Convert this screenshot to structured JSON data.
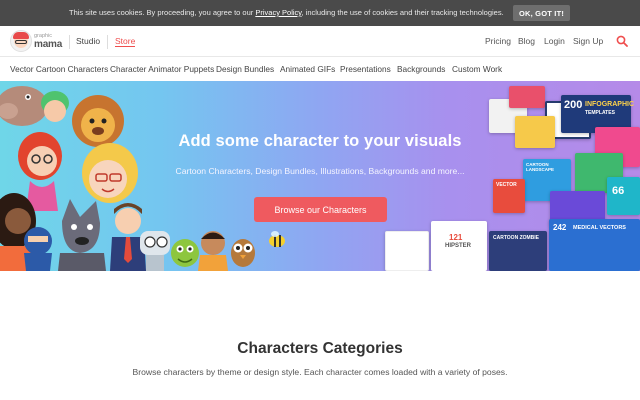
{
  "cookie": {
    "text_before": "This site uses cookies. By proceeding, you agree to our ",
    "policy_link": "Privacy Policy",
    "text_after": ", including the use of cookies and their tracking technologies.",
    "button": "OK, GOT IT!"
  },
  "header": {
    "logo_small": "graphic",
    "logo_big": "mama",
    "nav_left": [
      "Studio",
      "Store"
    ],
    "nav_right": [
      "Pricing",
      "Blog",
      "Login",
      "Sign Up"
    ]
  },
  "subnav": {
    "items": [
      "Vector Cartoon Characters",
      "Character Animator Puppets",
      "Design Bundles",
      "Animated GIFs",
      "Presentations",
      "Backgrounds",
      "Custom Work"
    ]
  },
  "hero": {
    "title": "Add some character to your visuals",
    "subtitle": "Cartoon Characters, Design Bundles, Illustrations, Backgrounds and more...",
    "button": "Browse our Characters",
    "covers": {
      "infographic_count": "200",
      "infographic_label": "INFOGRAPHIC",
      "templates_label": "TEMPLATES",
      "landscape_label": "CARTOON LANDSCAPE",
      "vector_label": "VECTOR",
      "hipster_count": "121",
      "hipster_label": "HIPSTER",
      "zombie_label": "CARTOON ZOMBIE",
      "medical_count": "242",
      "medical_label": "MEDICAL VECTORS",
      "side_count": "66"
    }
  },
  "categories": {
    "title": "Characters Categories",
    "subtitle": "Browse characters by theme or design style. Each character comes loaded with a variety of poses."
  },
  "colors": {
    "accent": "#ef4e4e",
    "button": "#ef5a5f",
    "cookie_bar": "#4a4a4a"
  }
}
